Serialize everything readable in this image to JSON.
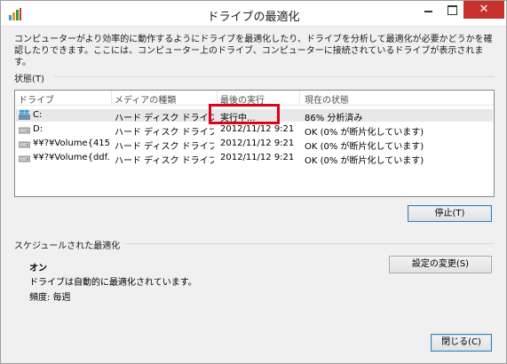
{
  "window": {
    "title": "ドライブの最適化",
    "close_label": "✕"
  },
  "description": "コンピューターがより効率的に動作するようにドライブを最適化したり、ドライブを分析して最適化が必要かどうかを確認したりできます。ここには、コンピューター上のドライブ、コンピューターに接続されているドライブが表示されます。",
  "status_section": {
    "label": "状態(T)",
    "columns": [
      "ドライブ",
      "メディアの種類",
      "最後の実行",
      "現在の状態"
    ],
    "rows": [
      {
        "drive": "C:",
        "media": "ハード ディスク ドライブ",
        "last_run": "実行中...",
        "status": "86% 分析済み",
        "icon": "windows-drive-icon"
      },
      {
        "drive": "D:",
        "media": "ハード ディスク ドライブ",
        "last_run": "2012/11/12 9:21",
        "status": "OK (0% が断片化しています)",
        "icon": "hard-drive-icon"
      },
      {
        "drive": "¥¥?¥Volume{415...",
        "media": "ハード ディスク ドライブ",
        "last_run": "2012/11/12 9:21",
        "status": "OK (0% が断片化しています)",
        "icon": "hard-drive-icon"
      },
      {
        "drive": "¥¥?¥Volume{ddf...",
        "media": "ハード ディスク ドライブ",
        "last_run": "2012/11/12 9:21",
        "status": "OK (0% が断片化しています)",
        "icon": "hard-drive-icon"
      }
    ],
    "stop_button": "停止(T)"
  },
  "schedule_section": {
    "label": "スケジュールされた最適化",
    "status": "オン",
    "description": "ドライブは自動的に最適化されています。",
    "frequency": "頻度: 毎週",
    "settings_button": "設定の変更(S)"
  },
  "close_button": "閉じる(C)",
  "colors": {
    "highlight": "#e0001a",
    "close_red": "#c7312b"
  }
}
